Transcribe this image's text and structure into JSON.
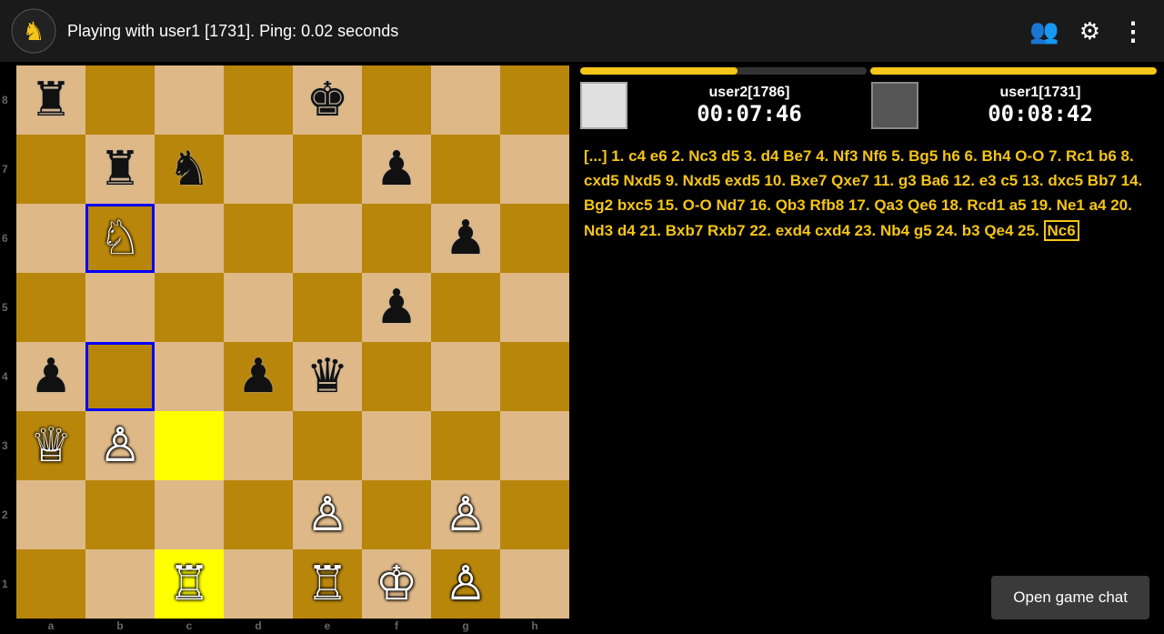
{
  "header": {
    "title": "Playing with user1 [1731]. Ping: 0.02 seconds",
    "logo_alt": "chess-logo"
  },
  "icons": {
    "users": "👥",
    "settings": "⚙",
    "more": "⋮"
  },
  "players": {
    "left": {
      "name": "user2[1786]",
      "timer": "00:07:46",
      "color": "white",
      "bar_pct": 55
    },
    "right": {
      "name": "user1[1731]",
      "timer": "00:08:42",
      "color": "black",
      "bar_pct": 100
    }
  },
  "move_history": "[...] 1. c4 e6 2. Nc3 d5 3. d4 Be7 4. Nf3 Nf6 5. Bg5 h6 6. Bh4 O-O 7. Rc1 b6 8. cxd5 Nxd5 9. Nxd5 exd5 10. Bxe7 Qxe7 11. g3 Ba6 12. e3 c5 13. dxc5 Bb7 14. Bg2 bxc5 15. O-O Nd7 16. Qb3 Rfb8 17. Qa3 Qe6 18. Rcd1 a5 19. Ne1 a4 20. Nd3 d4 21. Bxb7 Rxb7 22. exd4 cxd4 23. Nb4 g5 24. b3 Qe4 25. Nc6",
  "last_move": "Nc6",
  "chat_button_label": "Open game chat",
  "board": {
    "rank_labels": [
      "8",
      "7",
      "6",
      "5",
      "4",
      "3",
      "2",
      "1"
    ],
    "file_labels": [
      "a",
      "b",
      "c",
      "d",
      "e",
      "f",
      "g",
      "h"
    ],
    "highlighted_cells": [
      "b6",
      "b4",
      "c3",
      "c1"
    ],
    "yellow_cells": [
      "c3",
      "c1"
    ]
  }
}
